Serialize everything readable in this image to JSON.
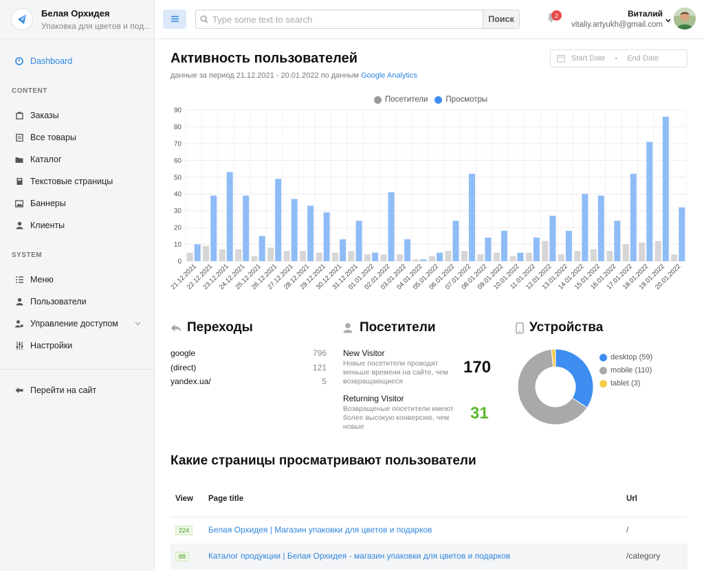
{
  "brand": {
    "title": "Белая Орхидея",
    "subtitle": "Упаковка для цветов и под..."
  },
  "sidebar": {
    "dashboard": "Dashboard",
    "content_section": "CONTENT",
    "content_items": [
      {
        "label": "Заказы",
        "icon": "bag-icon"
      },
      {
        "label": "Все товары",
        "icon": "clipboard-icon"
      },
      {
        "label": "Каталог",
        "icon": "folder-icon"
      },
      {
        "label": "Текстовые страницы",
        "icon": "book-icon"
      },
      {
        "label": "Баннеры",
        "icon": "image-icon"
      },
      {
        "label": "Клиенты",
        "icon": "user-icon"
      }
    ],
    "system_section": "SYSTEM",
    "system_items": [
      {
        "label": "Меню",
        "icon": "list-icon"
      },
      {
        "label": "Пользователи",
        "icon": "user-icon"
      },
      {
        "label": "Управление доступом",
        "icon": "user-lock-icon"
      },
      {
        "label": "Настройки",
        "icon": "sliders-icon"
      }
    ],
    "goto_site": "Перейти на сайт"
  },
  "header": {
    "search_placeholder": "Type some text to search",
    "search_button": "Поиск",
    "notifications": "2",
    "user_name": "Виталий",
    "user_email": "vitaliy.artyukh@gmail.com"
  },
  "main": {
    "title": "Активность пользователей",
    "subtitle_prefix": "данные за период 21.12.2021 - 20.01.2022 по данным ",
    "subtitle_link": "Google Analytics",
    "start_date": "Start Date",
    "end_date": "End Date",
    "date_sep": "-"
  },
  "chart_data": {
    "type": "bar",
    "categories": [
      "21.12.2021",
      "22.12.2021",
      "23.12.2021",
      "24.12.2021",
      "25.12.2021",
      "26.12.2021",
      "27.12.2021",
      "28.12.2021",
      "29.12.2021",
      "30.12.2021",
      "31.12.2021",
      "01.01.2022",
      "02.01.2022",
      "03.01.2022",
      "04.01.2022",
      "05.01.2022",
      "06.01.2022",
      "07.01.2022",
      "08.01.2022",
      "09.01.2022",
      "10.01.2022",
      "11.01.2022",
      "12.01.2022",
      "13.01.2022",
      "14.01.2022",
      "15.01.2022",
      "16.01.2022",
      "17.01.2022",
      "18.01.2022",
      "19.01.2022",
      "20.01.2022"
    ],
    "series": [
      {
        "name": "Посетители",
        "color": "#d6d6d6",
        "values": [
          5,
          9,
          7,
          7,
          3,
          8,
          6,
          6,
          5,
          5,
          6,
          4,
          4,
          4,
          1,
          3,
          6,
          6,
          4,
          5,
          3,
          5,
          12,
          4,
          6,
          7,
          6,
          10,
          11,
          12,
          4
        ]
      },
      {
        "name": "Просмотры",
        "color": "#8fbcf6",
        "values": [
          10,
          39,
          53,
          39,
          15,
          49,
          37,
          33,
          29,
          13,
          24,
          5,
          41,
          13,
          1,
          5,
          24,
          52,
          14,
          18,
          5,
          14,
          27,
          18,
          40,
          39,
          24,
          52,
          71,
          86,
          32
        ]
      }
    ],
    "legend_colors": [
      "#999999",
      "#3d8ef0"
    ],
    "ylim": [
      0,
      90
    ],
    "yticks": [
      0,
      10,
      20,
      30,
      40,
      50,
      60,
      70,
      80,
      90
    ],
    "grid": true,
    "legend": "top-center"
  },
  "referrals": {
    "title": "Переходы",
    "items": [
      {
        "name": "google",
        "count": "796"
      },
      {
        "name": "(direct)",
        "count": "121"
      },
      {
        "name": "yandex.ua/",
        "count": "5"
      }
    ]
  },
  "visitors": {
    "title": "Посетители",
    "new_name": "New Visitor",
    "new_desc": "Новые посетители проводят меньше времени на сайте, чем возвращающиеся",
    "new_count": "170",
    "ret_name": "Returning Visitor",
    "ret_desc": "Возвращеные посетители имеют более высокую конверсию, чем новые",
    "ret_count": "31",
    "ret_color": "#5cb82c"
  },
  "devices": {
    "title": "Устройства",
    "items": [
      {
        "label": "desktop (59)",
        "value": 59,
        "color": "#3d8ef0"
      },
      {
        "label": "mobile (110)",
        "value": 110,
        "color": "#a9a9a9"
      },
      {
        "label": "tablet (3)",
        "value": 3,
        "color": "#f6cb4a"
      }
    ]
  },
  "pages": {
    "title": "Какие страницы просматривают пользователи",
    "col_view": "View",
    "col_title": "Page title",
    "col_url": "Url",
    "rows": [
      {
        "view": "224",
        "title": "Белая Орхидея | Магазин упаковки для цветов и подарков",
        "url": "/"
      },
      {
        "view": "88",
        "title": "Каталог продукции | Белая Орхидея - магазин упаковки для цветов и подарков",
        "url": "/category"
      }
    ]
  }
}
